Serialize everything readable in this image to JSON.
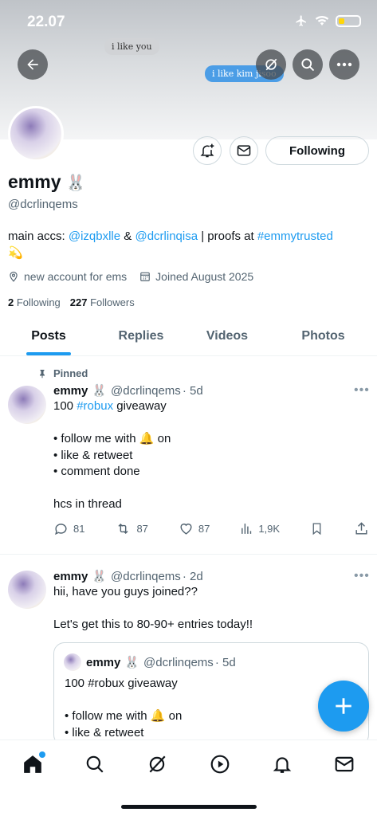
{
  "status_bar": {
    "time": "22.07"
  },
  "banner": {
    "bubble_left": "i like you",
    "bubble_right": "i like kim jisoo"
  },
  "profile": {
    "name": "emmy",
    "name_emoji": "🐰",
    "handle": "@dcrlinqems",
    "following_button": "Following",
    "bio": {
      "part1": "main accs: ",
      "mention1": "@izqbxlle",
      "part2": " & ",
      "mention2": "@dcrlinqisa",
      "part3": " | proofs at ",
      "hashtag": "#emmytrusted",
      "emoji": "💫"
    },
    "location": "new account for ems",
    "joined": "Joined August 2025",
    "following_count": "2",
    "following_label": "Following",
    "followers_count": "227",
    "followers_label": "Followers"
  },
  "tabs": [
    "Posts",
    "Replies",
    "Videos",
    "Photos"
  ],
  "tweets": [
    {
      "pinned_label": "Pinned",
      "name": "emmy",
      "emoji": "🐰",
      "handle": "@dcrlinqems",
      "time": "· 5d",
      "text_prefix": "100 ",
      "hashtag": "#robux",
      "text_suffix": " giveaway",
      "body_lines": "• follow me with 🔔 on\n• like & retweet\n• comment done\n\nhcs in thread",
      "replies": "81",
      "retweets": "87",
      "likes": "87",
      "views": "1,9K"
    },
    {
      "name": "emmy",
      "emoji": "🐰",
      "handle": "@dcrlinqems",
      "time": "· 2d",
      "text": "hii, have you guys joined??\n\nLet's get this to 80-90+ entries today!!",
      "quote": {
        "name": "emmy",
        "emoji": "🐰",
        "handle": "@dcrlinqems",
        "time": "· 5d",
        "text": "100 #robux giveaway\n\n• follow me with 🔔 on\n• like & retweet"
      }
    }
  ],
  "colors": {
    "accent": "#1d9bf0",
    "text": "#0f1419",
    "muted": "#536471"
  },
  "icons": {
    "top": [
      "back-arrow-icon",
      "grok-icon",
      "search-icon",
      "more-icon"
    ],
    "profile_actions": [
      "notification-bell-plus-icon",
      "message-icon"
    ],
    "meta": [
      "location-icon",
      "calendar-icon"
    ],
    "tweet_actions": [
      "reply-icon",
      "retweet-icon",
      "like-icon",
      "views-icon",
      "bookmark-icon",
      "share-icon"
    ],
    "bottom_nav": [
      "home-icon",
      "search-icon",
      "grok-icon",
      "video-icon",
      "notifications-icon",
      "messages-icon"
    ]
  }
}
